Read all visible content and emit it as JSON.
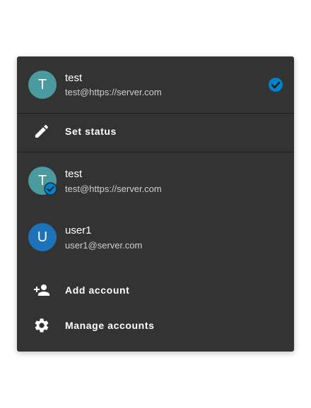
{
  "current_account": {
    "initial": "T",
    "name": "test",
    "email": "test@https://server.com",
    "avatar_color": "#4a9aa0",
    "check_color": "#0082c9"
  },
  "set_status": {
    "icon": "pencil-icon",
    "label": "Set status"
  },
  "accounts": [
    {
      "initial": "T",
      "name": "test",
      "email": "test@https://server.com",
      "avatar_color": "#4a9aa0",
      "active": true
    },
    {
      "initial": "U",
      "name": "user1",
      "email": "user1@server.com",
      "avatar_color": "#1e72b8",
      "active": false
    }
  ],
  "add_account": {
    "icon": "person-add-icon",
    "label": "Add account"
  },
  "manage_accounts": {
    "icon": "gear-icon",
    "label": "Manage accounts"
  },
  "colors": {
    "dialog_bg": "#333333",
    "accent": "#0082c9"
  }
}
